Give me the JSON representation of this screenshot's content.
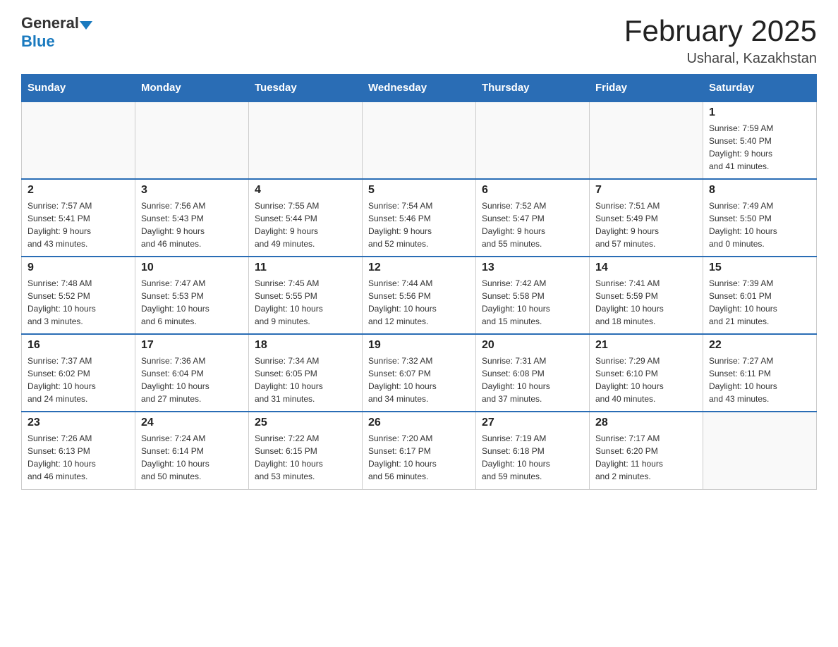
{
  "header": {
    "logo_general": "General",
    "logo_blue": "Blue",
    "title": "February 2025",
    "location": "Usharal, Kazakhstan"
  },
  "calendar": {
    "days_of_week": [
      "Sunday",
      "Monday",
      "Tuesday",
      "Wednesday",
      "Thursday",
      "Friday",
      "Saturday"
    ],
    "weeks": [
      [
        {
          "day": "",
          "info": ""
        },
        {
          "day": "",
          "info": ""
        },
        {
          "day": "",
          "info": ""
        },
        {
          "day": "",
          "info": ""
        },
        {
          "day": "",
          "info": ""
        },
        {
          "day": "",
          "info": ""
        },
        {
          "day": "1",
          "info": "Sunrise: 7:59 AM\nSunset: 5:40 PM\nDaylight: 9 hours\nand 41 minutes."
        }
      ],
      [
        {
          "day": "2",
          "info": "Sunrise: 7:57 AM\nSunset: 5:41 PM\nDaylight: 9 hours\nand 43 minutes."
        },
        {
          "day": "3",
          "info": "Sunrise: 7:56 AM\nSunset: 5:43 PM\nDaylight: 9 hours\nand 46 minutes."
        },
        {
          "day": "4",
          "info": "Sunrise: 7:55 AM\nSunset: 5:44 PM\nDaylight: 9 hours\nand 49 minutes."
        },
        {
          "day": "5",
          "info": "Sunrise: 7:54 AM\nSunset: 5:46 PM\nDaylight: 9 hours\nand 52 minutes."
        },
        {
          "day": "6",
          "info": "Sunrise: 7:52 AM\nSunset: 5:47 PM\nDaylight: 9 hours\nand 55 minutes."
        },
        {
          "day": "7",
          "info": "Sunrise: 7:51 AM\nSunset: 5:49 PM\nDaylight: 9 hours\nand 57 minutes."
        },
        {
          "day": "8",
          "info": "Sunrise: 7:49 AM\nSunset: 5:50 PM\nDaylight: 10 hours\nand 0 minutes."
        }
      ],
      [
        {
          "day": "9",
          "info": "Sunrise: 7:48 AM\nSunset: 5:52 PM\nDaylight: 10 hours\nand 3 minutes."
        },
        {
          "day": "10",
          "info": "Sunrise: 7:47 AM\nSunset: 5:53 PM\nDaylight: 10 hours\nand 6 minutes."
        },
        {
          "day": "11",
          "info": "Sunrise: 7:45 AM\nSunset: 5:55 PM\nDaylight: 10 hours\nand 9 minutes."
        },
        {
          "day": "12",
          "info": "Sunrise: 7:44 AM\nSunset: 5:56 PM\nDaylight: 10 hours\nand 12 minutes."
        },
        {
          "day": "13",
          "info": "Sunrise: 7:42 AM\nSunset: 5:58 PM\nDaylight: 10 hours\nand 15 minutes."
        },
        {
          "day": "14",
          "info": "Sunrise: 7:41 AM\nSunset: 5:59 PM\nDaylight: 10 hours\nand 18 minutes."
        },
        {
          "day": "15",
          "info": "Sunrise: 7:39 AM\nSunset: 6:01 PM\nDaylight: 10 hours\nand 21 minutes."
        }
      ],
      [
        {
          "day": "16",
          "info": "Sunrise: 7:37 AM\nSunset: 6:02 PM\nDaylight: 10 hours\nand 24 minutes."
        },
        {
          "day": "17",
          "info": "Sunrise: 7:36 AM\nSunset: 6:04 PM\nDaylight: 10 hours\nand 27 minutes."
        },
        {
          "day": "18",
          "info": "Sunrise: 7:34 AM\nSunset: 6:05 PM\nDaylight: 10 hours\nand 31 minutes."
        },
        {
          "day": "19",
          "info": "Sunrise: 7:32 AM\nSunset: 6:07 PM\nDaylight: 10 hours\nand 34 minutes."
        },
        {
          "day": "20",
          "info": "Sunrise: 7:31 AM\nSunset: 6:08 PM\nDaylight: 10 hours\nand 37 minutes."
        },
        {
          "day": "21",
          "info": "Sunrise: 7:29 AM\nSunset: 6:10 PM\nDaylight: 10 hours\nand 40 minutes."
        },
        {
          "day": "22",
          "info": "Sunrise: 7:27 AM\nSunset: 6:11 PM\nDaylight: 10 hours\nand 43 minutes."
        }
      ],
      [
        {
          "day": "23",
          "info": "Sunrise: 7:26 AM\nSunset: 6:13 PM\nDaylight: 10 hours\nand 46 minutes."
        },
        {
          "day": "24",
          "info": "Sunrise: 7:24 AM\nSunset: 6:14 PM\nDaylight: 10 hours\nand 50 minutes."
        },
        {
          "day": "25",
          "info": "Sunrise: 7:22 AM\nSunset: 6:15 PM\nDaylight: 10 hours\nand 53 minutes."
        },
        {
          "day": "26",
          "info": "Sunrise: 7:20 AM\nSunset: 6:17 PM\nDaylight: 10 hours\nand 56 minutes."
        },
        {
          "day": "27",
          "info": "Sunrise: 7:19 AM\nSunset: 6:18 PM\nDaylight: 10 hours\nand 59 minutes."
        },
        {
          "day": "28",
          "info": "Sunrise: 7:17 AM\nSunset: 6:20 PM\nDaylight: 11 hours\nand 2 minutes."
        },
        {
          "day": "",
          "info": ""
        }
      ]
    ]
  }
}
